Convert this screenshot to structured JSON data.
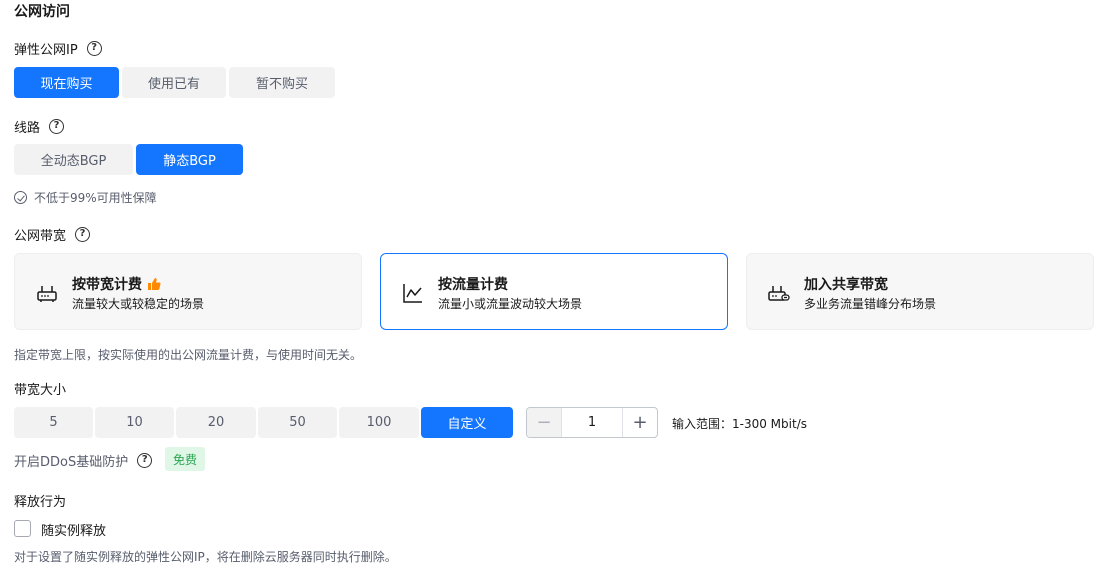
{
  "section": {
    "title": "公网访问"
  },
  "eip": {
    "label": "弹性公网IP",
    "options": [
      "现在购买",
      "使用已有",
      "暂不购买"
    ],
    "selected": "现在购买"
  },
  "line": {
    "label": "线路",
    "options": [
      "全动态BGP",
      "静态BGP"
    ],
    "selected": "静态BGP",
    "guarantee": "不低于99%可用性保障"
  },
  "bandwidth_billing": {
    "label": "公网带宽",
    "cards": [
      {
        "title": "按带宽计费",
        "desc": "流量较大或较稳定的场景",
        "icon": "router-icon",
        "recommended": true
      },
      {
        "title": "按流量计费",
        "desc": "流量小或流量波动较大场景",
        "icon": "line-chart-icon",
        "recommended": false
      },
      {
        "title": "加入共享带宽",
        "desc": "多业务流量错峰分布场景",
        "icon": "shared-router-icon",
        "recommended": false
      }
    ],
    "selected": "按流量计费",
    "note": "指定带宽上限，按实际使用的出公网流量计费，与使用时间无关。"
  },
  "bandwidth_size": {
    "label": "带宽大小",
    "options": [
      "5",
      "10",
      "20",
      "50",
      "100",
      "自定义"
    ],
    "selected": "自定义",
    "value": "1",
    "range": "输入范围：1-300 Mbit/s"
  },
  "ddos": {
    "label": "开启DDoS基础防护",
    "badge": "免费"
  },
  "release": {
    "label": "释放行为",
    "checkbox_label": "随实例释放",
    "checked": false,
    "note": "对于设置了随实例释放的弹性公网IP，将在删除云服务器同时执行删除。"
  },
  "colors": {
    "accent": "#1476ff",
    "free_badge_bg": "#e0f6e7",
    "free_badge_text": "#2aa653",
    "hot": "#ff8a00"
  }
}
